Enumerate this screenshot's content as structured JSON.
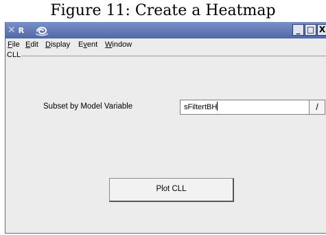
{
  "figure_caption": "Figure 11:  Create a Heatmap",
  "window": {
    "logo_text": "R",
    "logo_mark": "✕",
    "icons": [
      "swirl-icon",
      "minimize-icon",
      "maximize-icon",
      "close-icon"
    ],
    "buttons": {
      "minimize": "_",
      "maximize": "□",
      "close": "X"
    },
    "title_bar_color": "#5f78b8"
  },
  "menu": {
    "items": [
      {
        "label": "File",
        "underline": "F",
        "rest": "ile"
      },
      {
        "label": "Edit",
        "underline": "E",
        "rest": "dit"
      },
      {
        "label": "Display",
        "underline": "D",
        "rest": "isplay"
      },
      {
        "label": "Event",
        "prefix": "E",
        "underline": "v",
        "rest": "ent"
      },
      {
        "label": "Window",
        "underline": "W",
        "rest": "indow"
      }
    ]
  },
  "panel": {
    "group_label": "CLL",
    "subset_label": "Subset by Model Variable",
    "subset_value": "sFiltertBH",
    "edit_button_label": "/",
    "plot_button_label": "Plot CLL"
  }
}
